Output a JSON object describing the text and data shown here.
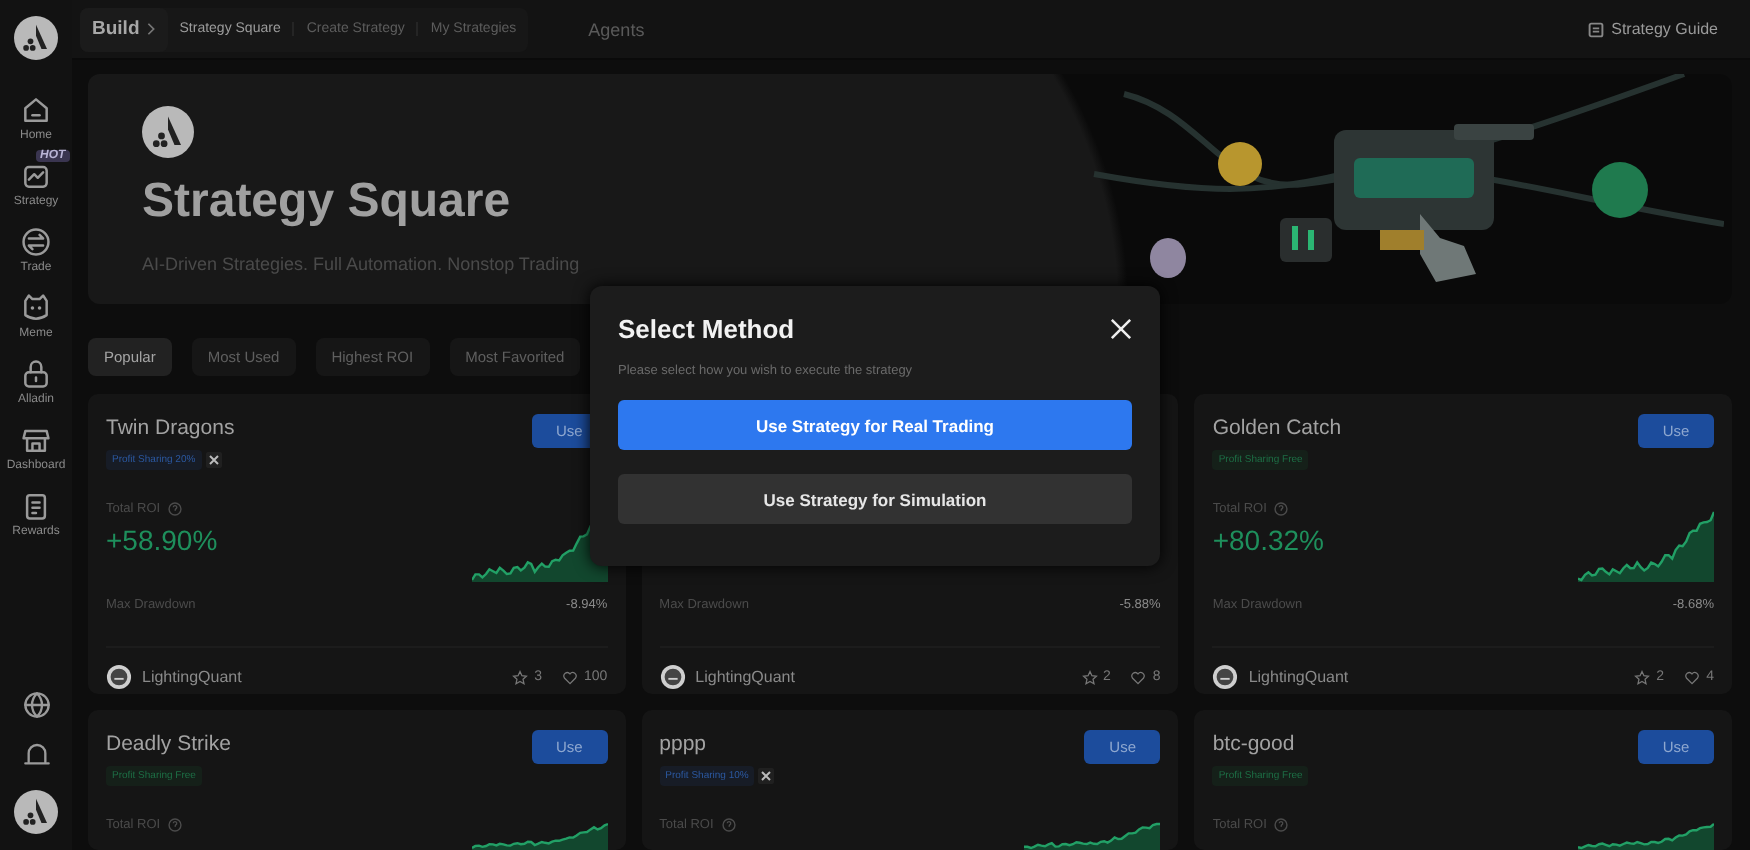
{
  "sidebar": {
    "items": [
      {
        "label": "Home"
      },
      {
        "label": "Strategy",
        "badge": "HOT"
      },
      {
        "label": "Trade"
      },
      {
        "label": "Meme"
      },
      {
        "label": "Alladin"
      },
      {
        "label": "Dashboard"
      },
      {
        "label": "Rewards"
      }
    ]
  },
  "breadcrumb": {
    "root": "Build",
    "tabs": [
      {
        "label": "Strategy Square",
        "selected": true
      },
      {
        "label": "Create Strategy",
        "selected": false
      },
      {
        "label": "My Strategies",
        "selected": false
      }
    ]
  },
  "top_nav": {
    "agents": "Agents",
    "guide": "Strategy Guide"
  },
  "banner": {
    "title": "Strategy Square",
    "subtitle": "AI-Driven Strategies. Full Automation. Nonstop Trading"
  },
  "filters": [
    {
      "label": "Popular",
      "selected": true
    },
    {
      "label": "Most Used",
      "selected": false
    },
    {
      "label": "Highest ROI",
      "selected": false
    },
    {
      "label": "Most Favorited",
      "selected": false
    }
  ],
  "cards": [
    {
      "title": "Twin Dragons",
      "tag": {
        "kind": "paid",
        "text": "Profit Sharing 20%"
      },
      "use": "Use",
      "roi_label": "Total ROI",
      "roi": "+58.90%",
      "drawdown_label": "Max Drawdown",
      "drawdown": "-8.94%",
      "author": "LightingQuant",
      "stars": "3",
      "likes": "100"
    },
    {
      "drawdown_label": "Max Drawdown",
      "drawdown": "-5.88%",
      "author": "LightingQuant",
      "stars": "2",
      "likes": "8"
    },
    {
      "title": "Golden Catch",
      "tag": {
        "kind": "free",
        "text": "Profit Sharing Free"
      },
      "use": "Use",
      "roi_label": "Total ROI",
      "roi": "+80.32%",
      "drawdown_label": "Max Drawdown",
      "drawdown": "-8.68%",
      "author": "LightingQuant",
      "stars": "2",
      "likes": "4"
    },
    {
      "title": "Deadly Strike",
      "tag": {
        "kind": "free",
        "text": "Profit Sharing Free"
      },
      "use": "Use",
      "roi_label": "Total ROI"
    },
    {
      "title": "pppp",
      "tag": {
        "kind": "paid",
        "text": "Profit Sharing 10%"
      },
      "use": "Use",
      "roi_label": "Total ROI"
    },
    {
      "title": "btc-good",
      "tag": {
        "kind": "free",
        "text": "Profit Sharing Free"
      },
      "use": "Use",
      "roi_label": "Total ROI"
    }
  ],
  "dialog": {
    "title": "Select Method",
    "message": "Please select how you wish to execute the strategy",
    "buttons": [
      {
        "kind": "primary",
        "label": "Use Strategy for Real Trading"
      },
      {
        "kind": "secondary",
        "label": "Use Strategy for Simulation"
      }
    ]
  }
}
